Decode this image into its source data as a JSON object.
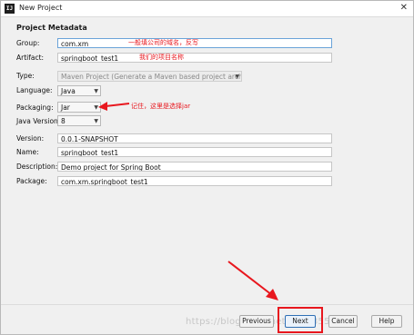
{
  "window": {
    "title": "New Project",
    "app_icon": "intellij-icon",
    "close_glyph": "✕"
  },
  "section": {
    "title": "Project Metadata"
  },
  "form": {
    "group": {
      "label": "Group:",
      "value": "com.xm"
    },
    "artifact": {
      "label": "Artifact:",
      "value": "springboot_test1"
    },
    "type": {
      "label": "Type:",
      "value": "Maven Project (Generate a Maven based project archive)"
    },
    "language": {
      "label": "Language:",
      "value": "Java"
    },
    "packaging": {
      "label": "Packaging:",
      "value": "Jar"
    },
    "java_version": {
      "label": "Java Version:",
      "value": "8"
    },
    "version": {
      "label": "Version:",
      "value": "0.0.1-SNAPSHOT"
    },
    "name": {
      "label": "Name:",
      "value": "springboot_test1"
    },
    "description": {
      "label": "Description:",
      "value": "Demo project for Spring Boot"
    },
    "package": {
      "label": "Package:",
      "value": "com.xm.springboot_test1"
    }
  },
  "annotations": {
    "group_note": "一般填公司的域名，反写",
    "artifact_note": "我们的项目名称",
    "packaging_note": "记住，这里是选择jar"
  },
  "buttons": {
    "previous": "Previous",
    "next": "Next",
    "cancel": "Cancel",
    "help": "Help"
  },
  "watermark": "https://blog.csdn.net/qq_43559485",
  "colors": {
    "annotation_red": "#e8171e",
    "focus_blue": "#6aa3d8"
  }
}
